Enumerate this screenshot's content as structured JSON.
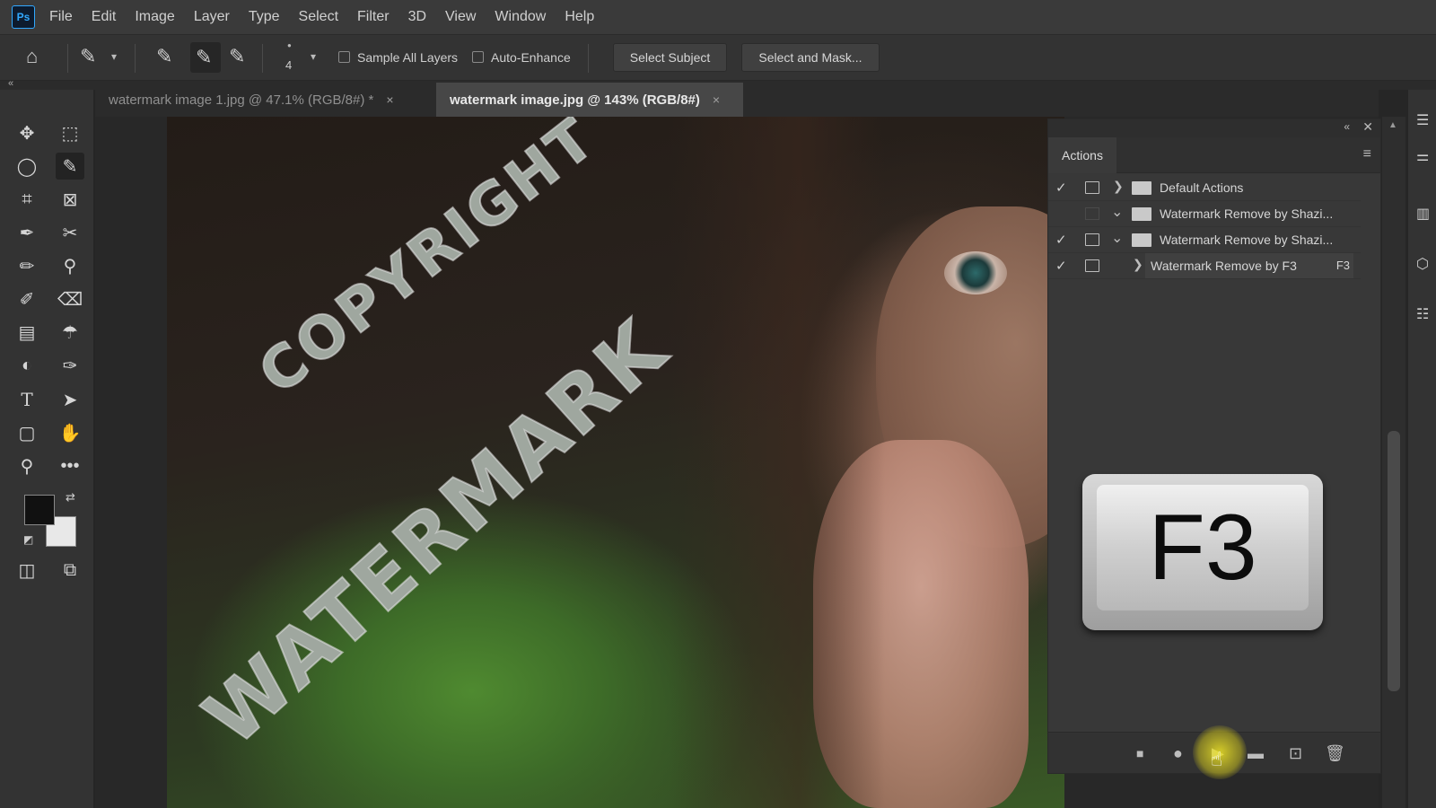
{
  "app": {
    "logo": "Ps"
  },
  "menu": [
    "File",
    "Edit",
    "Image",
    "Layer",
    "Type",
    "Select",
    "Filter",
    "3D",
    "View",
    "Window",
    "Help"
  ],
  "options": {
    "brush_size": "4",
    "sample_all_layers": "Sample All Layers",
    "auto_enhance": "Auto-Enhance",
    "select_subject": "Select Subject",
    "select_and_mask": "Select and Mask..."
  },
  "tabs": [
    {
      "title": "watermark image 1.jpg @ 47.1% (RGB/8#) *",
      "close": "×"
    },
    {
      "title": "watermark image.jpg @ 143% (RGB/8#)",
      "close": "×"
    }
  ],
  "canvas": {
    "watermark_1": "COPYRIGHT",
    "watermark_2": "WATERMARK"
  },
  "actions_panel": {
    "title": "Actions",
    "rows": [
      {
        "label": "Default Actions",
        "checked": true,
        "key": ""
      },
      {
        "label": "Watermark Remove by Shazi...",
        "checked": false,
        "key": ""
      },
      {
        "label": "Watermark Remove by Shazi...",
        "checked": true,
        "key": ""
      },
      {
        "label": "Watermark Remove by F3",
        "checked": true,
        "key": "F3"
      }
    ]
  },
  "key_overlay": "F3",
  "icons": {
    "check": "✓",
    "chevron_right": "❯",
    "chevron_down": "⌄"
  },
  "colors": {
    "foreground": "#111111",
    "background": "#e8e8e8",
    "accent": "#31a8ff"
  }
}
